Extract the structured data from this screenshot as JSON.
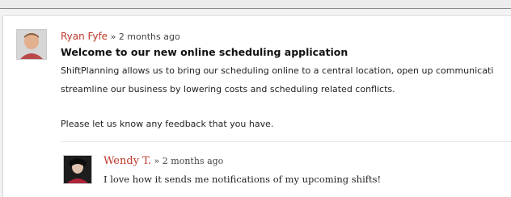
{
  "post": {
    "author": "Ryan Fyfe",
    "separator": " » ",
    "timestamp": "2 months ago",
    "title": "Welcome to our new online scheduling application",
    "body_line1": "ShiftPlanning allows us to bring our scheduling online to a central location, open up communicati",
    "body_line2": "streamline our business by lowering costs and scheduling related conflicts.",
    "body_line3": "Please let us know any feedback that you have."
  },
  "reply": {
    "author": "Wendy T.",
    "separator": " » ",
    "timestamp": "2 months ago",
    "text": "I love how it sends me notifications of my upcoming shifts!"
  },
  "colors": {
    "author": "#c0392b",
    "background": "#f2f2f2",
    "panel": "#ffffff"
  },
  "icons": {
    "post_avatar": "user-avatar-photo",
    "reply_avatar": "user-avatar-photo"
  }
}
